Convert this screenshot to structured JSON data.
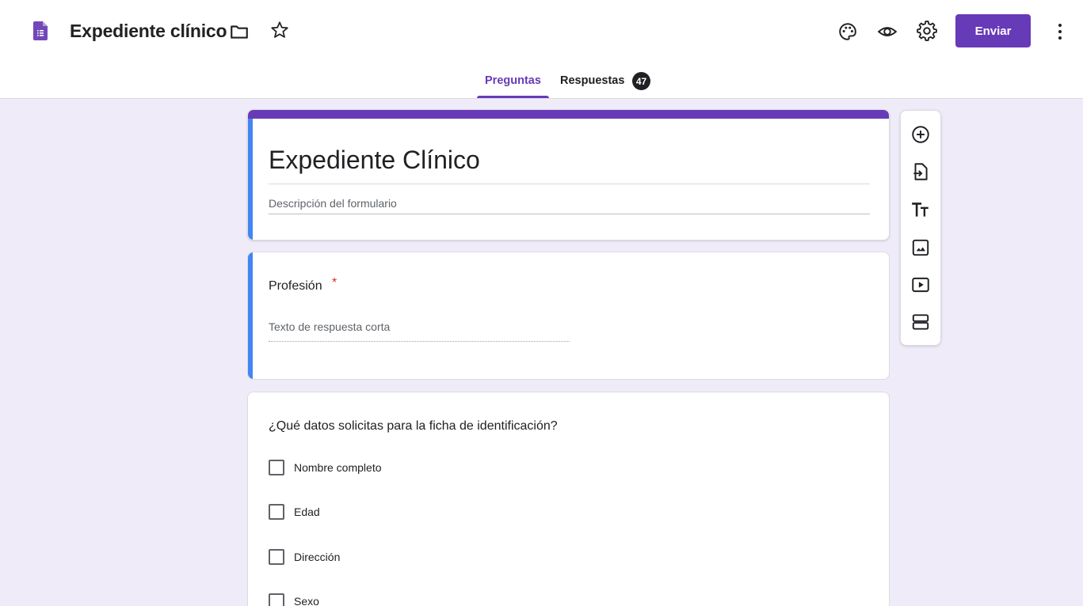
{
  "header": {
    "doc_title": "Expediente clínico",
    "send_label": "Enviar",
    "icons": [
      "forms-doc-icon",
      "folder-icon",
      "star-icon",
      "palette-icon",
      "preview-eye-icon",
      "settings-gear-icon",
      "more-vert-icon"
    ]
  },
  "tabs": [
    {
      "label": "Preguntas",
      "active": true
    },
    {
      "label": "Respuestas",
      "badge": "47"
    }
  ],
  "form": {
    "title": "Expediente Clínico",
    "description_placeholder": "Descripción del formulario"
  },
  "questions": [
    {
      "label": "Profesión",
      "required_mark": "*",
      "answer_placeholder": "Texto de respuesta corta"
    },
    {
      "label": "¿Qué datos solicitas para la ficha de identificación?",
      "options": [
        "Nombre completo",
        "Edad",
        "Dirección",
        "Sexo"
      ]
    }
  ],
  "side_toolbar": {
    "icons": [
      "add-question-icon",
      "import-questions-icon",
      "add-title-icon",
      "add-image-icon",
      "add-video-icon",
      "add-section-icon"
    ]
  },
  "colors": {
    "accent": "#673ab7",
    "active_card": "#4285f4",
    "background": "#f0ebf8",
    "required": "#d93025"
  }
}
